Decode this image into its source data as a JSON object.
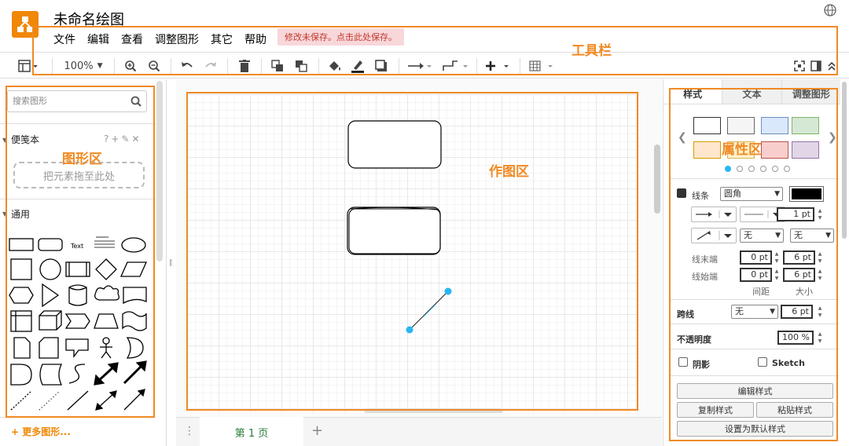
{
  "app": {
    "title": "未命名绘图",
    "unsaved_notice": "修改未保存。点击此处保存。"
  },
  "menu": [
    "文件",
    "编辑",
    "查看",
    "调整图形",
    "其它",
    "帮助"
  ],
  "toolbar": {
    "zoom": "100%",
    "items": [
      "format-panel-icon",
      "zoom-in-icon",
      "zoom-out-icon",
      "undo-icon",
      "redo-icon",
      "delete-icon",
      "to-front-icon",
      "to-back-icon",
      "fill-color-icon",
      "line-color-icon",
      "shadow-icon",
      "connection-icon",
      "waypoints-icon",
      "insert-icon",
      "table-icon",
      "fit-icon",
      "panel-toggle-icon",
      "collapse-icon"
    ]
  },
  "callouts": {
    "toolbar": "工具栏",
    "shapes": "图形区",
    "canvas": "作图区",
    "properties": "属性区"
  },
  "left_panel": {
    "search_placeholder": "搜索图形",
    "scratchpad_title": "便笺本",
    "scratchpad_tools": "?+✎✕",
    "dropzone_text": "把元素拖至此处",
    "general_title": "通用",
    "text_shape_label": "Text",
    "more_shapes": "+ 更多图形..."
  },
  "page_bar": {
    "page_tab": "第 1 页",
    "dots": "⋮",
    "add": "+"
  },
  "right_panel": {
    "tabs": [
      "样式",
      "文本",
      "调整图形"
    ],
    "swatches": [
      "#ffffff",
      "#f5f5f5",
      "#dae8fc",
      "#d5e8d4",
      "#ffe6cc",
      "#fff2cc",
      "#f8cecc",
      "#e1d5e7"
    ],
    "swatch_borders": [
      "#333333",
      "#666666",
      "#6c8ebf",
      "#82b366",
      "#d79b00",
      "#d6b656",
      "#b85450",
      "#9673a6"
    ],
    "line_label": "线条",
    "line_style": "圆角",
    "line_width": "1 pt",
    "none_a": "无",
    "none_b": "无",
    "line_end_label": "线末端",
    "line_start_label": "线始端",
    "end_spacing": "0 pt",
    "end_size": "6 pt",
    "start_spacing": "0 pt",
    "start_size": "6 pt",
    "spacing_label": "间距",
    "size_label": "大小",
    "jump_label": "跨线",
    "jump_style": "无",
    "jump_size": "6 pt",
    "opacity_label": "不透明度",
    "opacity_value": "100 %",
    "shadow_label": "阴影",
    "sketch_label": "Sketch",
    "edit_style": "编辑样式",
    "copy_style": "复制样式",
    "paste_style": "粘贴样式",
    "set_default": "设置为默认样式"
  },
  "colors": {
    "accent": "#f08705",
    "callout": "#f08a24",
    "selection": "#29b6f2",
    "page_tab_text": "#2a7c3b"
  }
}
